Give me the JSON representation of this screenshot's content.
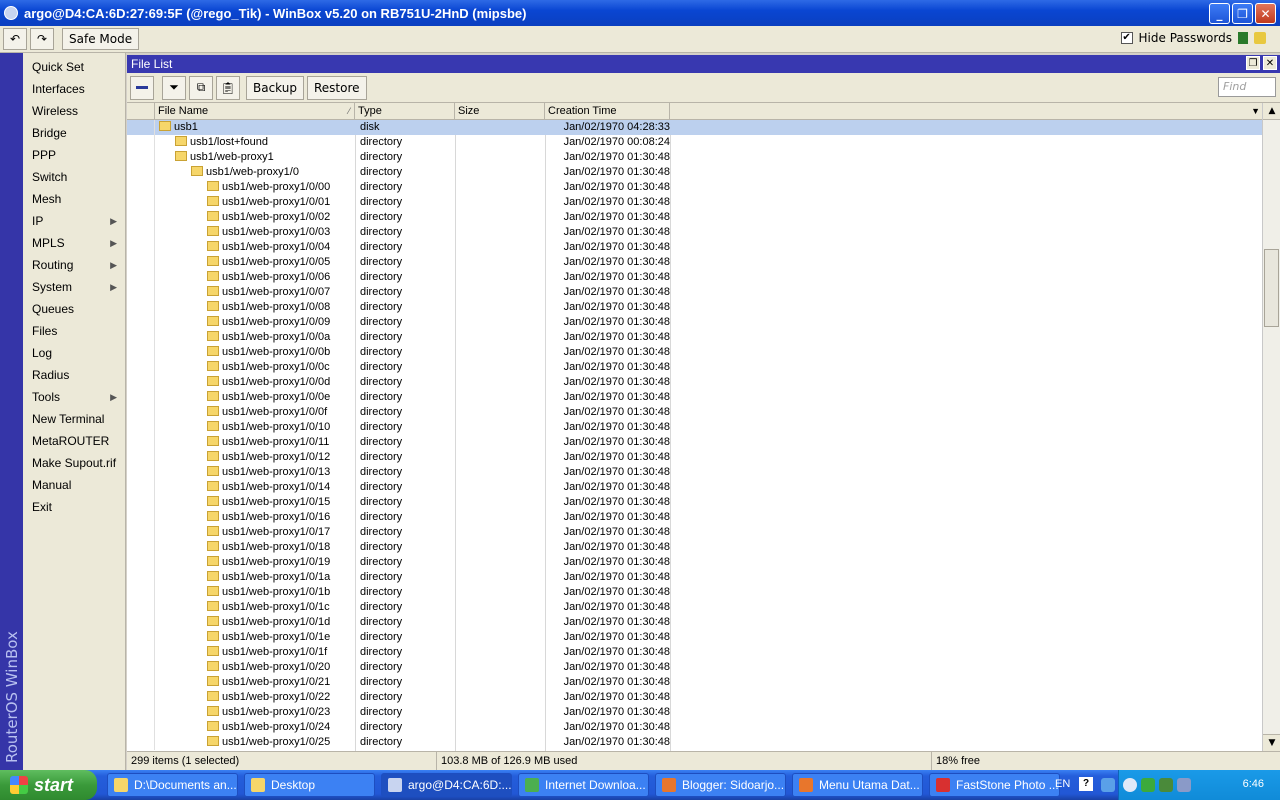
{
  "window": {
    "title": "argo@D4:CA:6D:27:69:5F (@rego_Tik) - WinBox v5.20 on RB751U-2HnD (mipsbe)"
  },
  "toolbar": {
    "safe_mode_label": "Safe Mode",
    "hide_passwords_label": "Hide Passwords",
    "hide_passwords_checked": "✔"
  },
  "brand": {
    "vertical_text": "RouterOS WinBox"
  },
  "sidebar": {
    "items": [
      {
        "label": "Quick Set",
        "sub": false
      },
      {
        "label": "Interfaces",
        "sub": false
      },
      {
        "label": "Wireless",
        "sub": false
      },
      {
        "label": "Bridge",
        "sub": false
      },
      {
        "label": "PPP",
        "sub": false
      },
      {
        "label": "Switch",
        "sub": false
      },
      {
        "label": "Mesh",
        "sub": false
      },
      {
        "label": "IP",
        "sub": true
      },
      {
        "label": "MPLS",
        "sub": true
      },
      {
        "label": "Routing",
        "sub": true
      },
      {
        "label": "System",
        "sub": true
      },
      {
        "label": "Queues",
        "sub": false
      },
      {
        "label": "Files",
        "sub": false
      },
      {
        "label": "Log",
        "sub": false
      },
      {
        "label": "Radius",
        "sub": false
      },
      {
        "label": "Tools",
        "sub": true
      },
      {
        "label": "New Terminal",
        "sub": false
      },
      {
        "label": "MetaROUTER",
        "sub": false
      },
      {
        "label": "Make Supout.rif",
        "sub": false
      },
      {
        "label": "Manual",
        "sub": false
      },
      {
        "label": "Exit",
        "sub": false
      }
    ]
  },
  "file_list": {
    "title": "File List",
    "backup_label": "Backup",
    "restore_label": "Restore",
    "find_placeholder": "Find",
    "columns": {
      "name": "File Name",
      "type": "Type",
      "size": "Size",
      "time": "Creation Time"
    },
    "rows": [
      {
        "name": "usb1",
        "indent": 0,
        "type": "disk",
        "size": "",
        "time": "Jan/02/1970 04:28:33",
        "selected": true
      },
      {
        "name": "usb1/lost+found",
        "indent": 1,
        "type": "directory",
        "size": "",
        "time": "Jan/02/1970 00:08:24"
      },
      {
        "name": "usb1/web-proxy1",
        "indent": 1,
        "type": "directory",
        "size": "",
        "time": "Jan/02/1970 01:30:48"
      },
      {
        "name": "usb1/web-proxy1/0",
        "indent": 2,
        "type": "directory",
        "size": "",
        "time": "Jan/02/1970 01:30:48"
      },
      {
        "name": "usb1/web-proxy1/0/00",
        "indent": 3,
        "type": "directory",
        "size": "",
        "time": "Jan/02/1970 01:30:48"
      },
      {
        "name": "usb1/web-proxy1/0/01",
        "indent": 3,
        "type": "directory",
        "size": "",
        "time": "Jan/02/1970 01:30:48"
      },
      {
        "name": "usb1/web-proxy1/0/02",
        "indent": 3,
        "type": "directory",
        "size": "",
        "time": "Jan/02/1970 01:30:48"
      },
      {
        "name": "usb1/web-proxy1/0/03",
        "indent": 3,
        "type": "directory",
        "size": "",
        "time": "Jan/02/1970 01:30:48"
      },
      {
        "name": "usb1/web-proxy1/0/04",
        "indent": 3,
        "type": "directory",
        "size": "",
        "time": "Jan/02/1970 01:30:48"
      },
      {
        "name": "usb1/web-proxy1/0/05",
        "indent": 3,
        "type": "directory",
        "size": "",
        "time": "Jan/02/1970 01:30:48"
      },
      {
        "name": "usb1/web-proxy1/0/06",
        "indent": 3,
        "type": "directory",
        "size": "",
        "time": "Jan/02/1970 01:30:48"
      },
      {
        "name": "usb1/web-proxy1/0/07",
        "indent": 3,
        "type": "directory",
        "size": "",
        "time": "Jan/02/1970 01:30:48"
      },
      {
        "name": "usb1/web-proxy1/0/08",
        "indent": 3,
        "type": "directory",
        "size": "",
        "time": "Jan/02/1970 01:30:48"
      },
      {
        "name": "usb1/web-proxy1/0/09",
        "indent": 3,
        "type": "directory",
        "size": "",
        "time": "Jan/02/1970 01:30:48"
      },
      {
        "name": "usb1/web-proxy1/0/0a",
        "indent": 3,
        "type": "directory",
        "size": "",
        "time": "Jan/02/1970 01:30:48"
      },
      {
        "name": "usb1/web-proxy1/0/0b",
        "indent": 3,
        "type": "directory",
        "size": "",
        "time": "Jan/02/1970 01:30:48"
      },
      {
        "name": "usb1/web-proxy1/0/0c",
        "indent": 3,
        "type": "directory",
        "size": "",
        "time": "Jan/02/1970 01:30:48"
      },
      {
        "name": "usb1/web-proxy1/0/0d",
        "indent": 3,
        "type": "directory",
        "size": "",
        "time": "Jan/02/1970 01:30:48"
      },
      {
        "name": "usb1/web-proxy1/0/0e",
        "indent": 3,
        "type": "directory",
        "size": "",
        "time": "Jan/02/1970 01:30:48"
      },
      {
        "name": "usb1/web-proxy1/0/0f",
        "indent": 3,
        "type": "directory",
        "size": "",
        "time": "Jan/02/1970 01:30:48"
      },
      {
        "name": "usb1/web-proxy1/0/10",
        "indent": 3,
        "type": "directory",
        "size": "",
        "time": "Jan/02/1970 01:30:48"
      },
      {
        "name": "usb1/web-proxy1/0/11",
        "indent": 3,
        "type": "directory",
        "size": "",
        "time": "Jan/02/1970 01:30:48"
      },
      {
        "name": "usb1/web-proxy1/0/12",
        "indent": 3,
        "type": "directory",
        "size": "",
        "time": "Jan/02/1970 01:30:48"
      },
      {
        "name": "usb1/web-proxy1/0/13",
        "indent": 3,
        "type": "directory",
        "size": "",
        "time": "Jan/02/1970 01:30:48"
      },
      {
        "name": "usb1/web-proxy1/0/14",
        "indent": 3,
        "type": "directory",
        "size": "",
        "time": "Jan/02/1970 01:30:48"
      },
      {
        "name": "usb1/web-proxy1/0/15",
        "indent": 3,
        "type": "directory",
        "size": "",
        "time": "Jan/02/1970 01:30:48"
      },
      {
        "name": "usb1/web-proxy1/0/16",
        "indent": 3,
        "type": "directory",
        "size": "",
        "time": "Jan/02/1970 01:30:48"
      },
      {
        "name": "usb1/web-proxy1/0/17",
        "indent": 3,
        "type": "directory",
        "size": "",
        "time": "Jan/02/1970 01:30:48"
      },
      {
        "name": "usb1/web-proxy1/0/18",
        "indent": 3,
        "type": "directory",
        "size": "",
        "time": "Jan/02/1970 01:30:48"
      },
      {
        "name": "usb1/web-proxy1/0/19",
        "indent": 3,
        "type": "directory",
        "size": "",
        "time": "Jan/02/1970 01:30:48"
      },
      {
        "name": "usb1/web-proxy1/0/1a",
        "indent": 3,
        "type": "directory",
        "size": "",
        "time": "Jan/02/1970 01:30:48"
      },
      {
        "name": "usb1/web-proxy1/0/1b",
        "indent": 3,
        "type": "directory",
        "size": "",
        "time": "Jan/02/1970 01:30:48"
      },
      {
        "name": "usb1/web-proxy1/0/1c",
        "indent": 3,
        "type": "directory",
        "size": "",
        "time": "Jan/02/1970 01:30:48"
      },
      {
        "name": "usb1/web-proxy1/0/1d",
        "indent": 3,
        "type": "directory",
        "size": "",
        "time": "Jan/02/1970 01:30:48"
      },
      {
        "name": "usb1/web-proxy1/0/1e",
        "indent": 3,
        "type": "directory",
        "size": "",
        "time": "Jan/02/1970 01:30:48"
      },
      {
        "name": "usb1/web-proxy1/0/1f",
        "indent": 3,
        "type": "directory",
        "size": "",
        "time": "Jan/02/1970 01:30:48"
      },
      {
        "name": "usb1/web-proxy1/0/20",
        "indent": 3,
        "type": "directory",
        "size": "",
        "time": "Jan/02/1970 01:30:48"
      },
      {
        "name": "usb1/web-proxy1/0/21",
        "indent": 3,
        "type": "directory",
        "size": "",
        "time": "Jan/02/1970 01:30:48"
      },
      {
        "name": "usb1/web-proxy1/0/22",
        "indent": 3,
        "type": "directory",
        "size": "",
        "time": "Jan/02/1970 01:30:48"
      },
      {
        "name": "usb1/web-proxy1/0/23",
        "indent": 3,
        "type": "directory",
        "size": "",
        "time": "Jan/02/1970 01:30:48"
      },
      {
        "name": "usb1/web-proxy1/0/24",
        "indent": 3,
        "type": "directory",
        "size": "",
        "time": "Jan/02/1970 01:30:48"
      },
      {
        "name": "usb1/web-proxy1/0/25",
        "indent": 3,
        "type": "directory",
        "size": "",
        "time": "Jan/02/1970 01:30:48"
      }
    ],
    "status": {
      "items": "299 items (1 selected)",
      "usage": "103.8 MB of 126.9 MB used",
      "free": "18% free"
    }
  },
  "taskbar": {
    "start_label": "start",
    "tasks": [
      {
        "label": "D:\\Documents an...",
        "icon": "folder-icon",
        "color": "#f6d66a",
        "active": false
      },
      {
        "label": "Desktop",
        "icon": "folder-icon",
        "color": "#f6d66a",
        "active": false
      },
      {
        "label": "argo@D4:CA:6D:...",
        "icon": "winbox-icon",
        "color": "#c8d4f0",
        "active": true
      },
      {
        "label": "Internet Downloa...",
        "icon": "globe-icon",
        "color": "#4caf50",
        "active": false
      },
      {
        "label": "Blogger: Sidoarjo...",
        "icon": "firefox-icon",
        "color": "#e8762c",
        "active": false
      },
      {
        "label": "Menu Utama Dat...",
        "icon": "firefox-icon",
        "color": "#e8762c",
        "active": false
      },
      {
        "label": "FastStone Photo ...",
        "icon": "photo-icon",
        "color": "#d83030",
        "active": false
      }
    ],
    "lang": "EN",
    "clock": "6:46"
  }
}
